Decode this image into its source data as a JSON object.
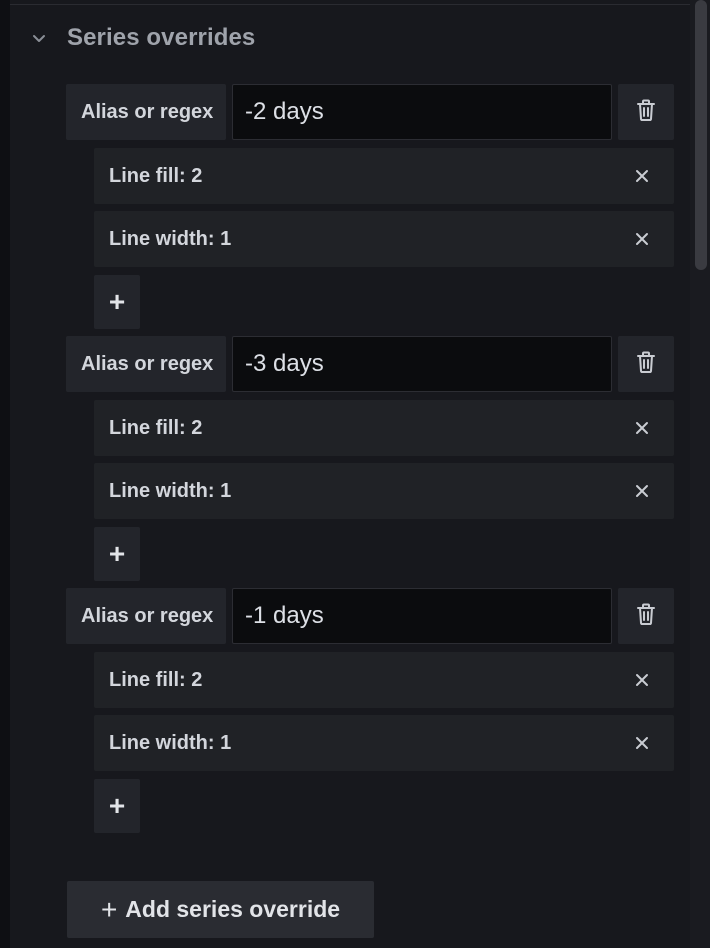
{
  "section": {
    "title": "Series overrides",
    "collapse_icon": "chevron-down-icon"
  },
  "overrides": [
    {
      "alias_label": "Alias or regex",
      "alias_value": "-2 days",
      "properties": [
        {
          "label": "Line fill: 2"
        },
        {
          "label": "Line width: 1"
        }
      ],
      "add_property_label": "+"
    },
    {
      "alias_label": "Alias or regex",
      "alias_value": "-3 days",
      "properties": [
        {
          "label": "Line fill: 2"
        },
        {
          "label": "Line width: 1"
        }
      ],
      "add_property_label": "+"
    },
    {
      "alias_label": "Alias or regex",
      "alias_value": "-1 days",
      "properties": [
        {
          "label": "Line fill: 2"
        },
        {
          "label": "Line width: 1"
        }
      ],
      "add_property_label": "+"
    }
  ],
  "add_override": {
    "plus": "+",
    "label": "Add series override"
  },
  "icons": {
    "delete": "trash-icon",
    "remove": "close-icon"
  },
  "colors": {
    "background": "#111217",
    "panel": "#17181d",
    "label_bg": "#23252b",
    "input_bg": "#0b0c0e",
    "text": "#d3d6dc",
    "muted_text": "#9fa3ab"
  }
}
